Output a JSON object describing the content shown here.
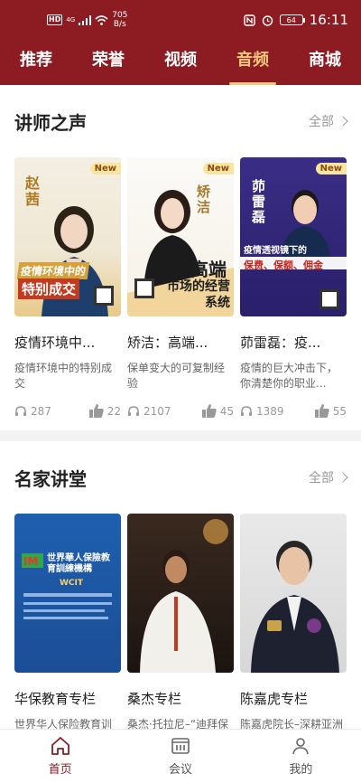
{
  "status_bar": {
    "hd": "HD",
    "net": "4G",
    "speed_value": "705",
    "speed_unit": "B/s",
    "battery": "64",
    "time": "16:11"
  },
  "tabs": [
    {
      "label": "推荐"
    },
    {
      "label": "荣誉"
    },
    {
      "label": "视频"
    },
    {
      "label": "音频"
    },
    {
      "label": "商城"
    }
  ],
  "sections": [
    {
      "title": "讲师之声",
      "more": "全部",
      "cards": [
        {
          "title": "疫情环境中...",
          "desc": "疫情环境中的特别成交",
          "plays": "287",
          "likes": "22",
          "badge": "New",
          "art_top": "疫情环境中的",
          "art_bottom": "特别成交",
          "name": "赵茜"
        },
        {
          "title": "矫洁：高端...",
          "desc": "保单变大的可复制经验",
          "plays": "2107",
          "likes": "45",
          "badge": "New",
          "art_top": "高端",
          "art_bottom": "市场的经营系统",
          "name": "矫洁"
        },
        {
          "title": "茆雷磊：疫...",
          "desc": "疫情的巨大冲击下，你清楚你的职业...",
          "plays": "1389",
          "likes": "55",
          "badge": "New",
          "art_top": "疫情透视镜下的",
          "art_bottom": "保费、保额、佣金",
          "name": "茆雷磊"
        }
      ]
    },
    {
      "title": "名家讲堂",
      "more": "全部",
      "cards": [
        {
          "title": "华保教育专栏",
          "desc": "世界华人保险教育训练机构资深讲师...",
          "logo_text": "世界華人保險教育訓練機構",
          "logo_sub": "WCIT"
        },
        {
          "title": "桑杰专栏",
          "desc": "桑杰·托拉尼–“迪拜保险王”科长是为..."
        },
        {
          "title": "陈嘉虎专栏",
          "desc": "陈嘉虎院长–深耕亚洲各个保险市场..."
        }
      ]
    }
  ],
  "bottom_nav": [
    {
      "label": "首页",
      "icon": "home-icon"
    },
    {
      "label": "会议",
      "icon": "meeting-icon"
    },
    {
      "label": "我的",
      "icon": "profile-icon"
    }
  ],
  "colors": {
    "brand": "#8c1c22",
    "accent": "#f2c77b"
  }
}
